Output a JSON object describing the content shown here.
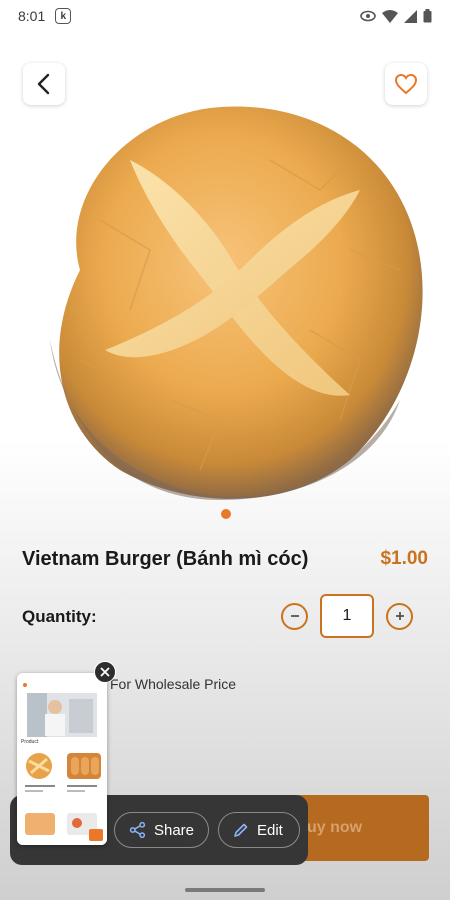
{
  "status_bar": {
    "time": "8:01",
    "k_badge": "k",
    "icons": [
      "eye-icon",
      "wifi-icon",
      "signal-icon",
      "battery-icon"
    ]
  },
  "header": {
    "back_icon": "chevron-left-icon",
    "favorite_icon": "heart-outline-icon"
  },
  "product": {
    "name": "Vietnam Burger (Bánh mì cóc)",
    "price": "$1.00",
    "image": "round bread roll with cross-cut crust",
    "carousel_active_index": 0
  },
  "quantity": {
    "label": "Quantity:",
    "value": "1",
    "decrease_icon": "minus-icon",
    "increase_icon": "plus-icon"
  },
  "wholesale_text": "For Wholesale Price",
  "buy_button_label": "uy now",
  "screenshot_overlay": {
    "thumbnail_label": "Product",
    "close_icon": "close-icon",
    "share_label": "Share",
    "share_icon": "share-icon",
    "edit_label": "Edit",
    "edit_icon": "pencil-icon"
  },
  "colors": {
    "accent": "#c9731f",
    "accent_dot": "#e9782b",
    "buy_button": "#b56a1f",
    "overlay_bg": "#363636"
  }
}
